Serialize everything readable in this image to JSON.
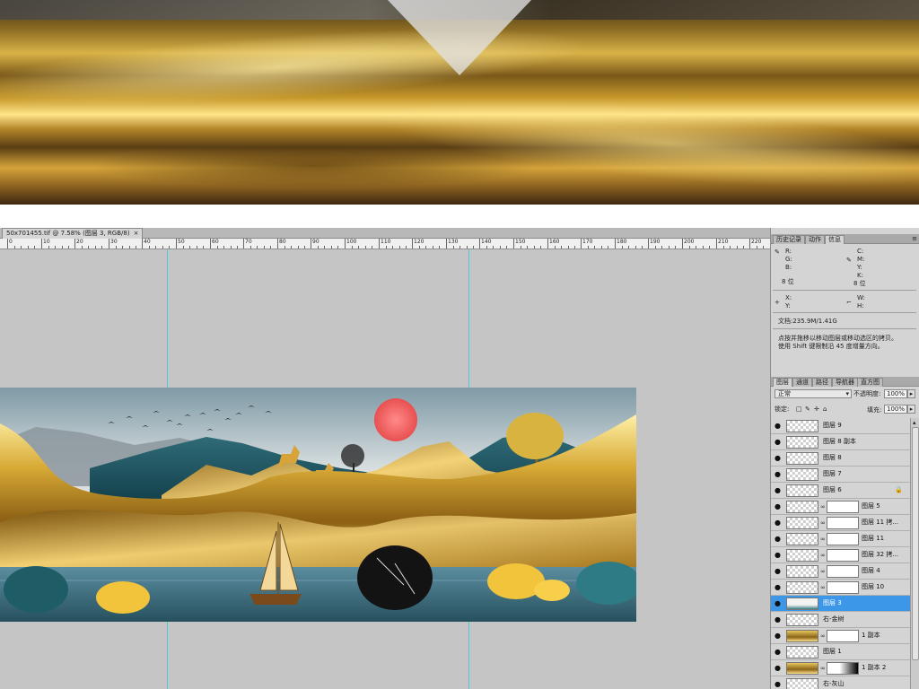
{
  "document": {
    "tab_title": "50x701455.tif @ 7.58% (图层 3, RGB/8)",
    "tab_close": "×",
    "ruler_labels": [
      "0",
      "10",
      "20",
      "30",
      "40",
      "50",
      "60",
      "70",
      "80",
      "90",
      "100",
      "110",
      "120",
      "130",
      "140",
      "150",
      "160",
      "170",
      "180",
      "190",
      "200",
      "210",
      "220"
    ]
  },
  "panels": {
    "tabs": [
      {
        "label": "历史记录",
        "active": false
      },
      {
        "label": "动作",
        "active": false
      },
      {
        "label": "信息",
        "active": true
      }
    ],
    "menu_glyph": "≡",
    "info": {
      "r": "R:",
      "g": "G:",
      "b": "B:",
      "c": "C:",
      "m": "M:",
      "y": "Y:",
      "k": "K:",
      "bit_left": "8 位",
      "bit_right": "8 位",
      "x": "X:",
      "ylbl": "Y:",
      "w": "W:",
      "h": "H:",
      "doc_size": "文档:235.9M/1.41G",
      "hint_line1": "点按并拖移以移动图层或移动选区的拷贝。",
      "hint_line2": "使用 Shift 键限制沿 45 度增量方向。"
    },
    "layers_tabs": [
      {
        "label": "图层",
        "active": true
      },
      {
        "label": "通道",
        "active": false
      },
      {
        "label": "路径",
        "active": false
      },
      {
        "label": "导航器",
        "active": false
      },
      {
        "label": "直方图",
        "active": false
      }
    ],
    "blend_mode": "正常",
    "opacity_label": "不透明度:",
    "opacity_value": "100%",
    "lock_label": "锁定:",
    "fill_label": "填充:",
    "fill_value": "100%",
    "layers": [
      {
        "name": "图层 9",
        "mask": "",
        "thumb": "checker",
        "selected": false,
        "locked": false
      },
      {
        "name": "图层 8 副本",
        "mask": "",
        "thumb": "checker",
        "selected": false,
        "locked": false
      },
      {
        "name": "图层 8",
        "mask": "",
        "thumb": "checker",
        "selected": false,
        "locked": false
      },
      {
        "name": "图层 7",
        "mask": "",
        "thumb": "checker",
        "selected": false,
        "locked": false
      },
      {
        "name": "图层 6",
        "mask": "",
        "thumb": "checker",
        "selected": false,
        "locked": true
      },
      {
        "name": "图层 5",
        "mask": "white",
        "thumb": "checker",
        "selected": false,
        "locked": false
      },
      {
        "name": "图层 11 拷...",
        "mask": "white",
        "thumb": "checker",
        "selected": false,
        "locked": false
      },
      {
        "name": "图层 11",
        "mask": "white",
        "thumb": "checker",
        "selected": false,
        "locked": false
      },
      {
        "name": "图层 32 拷...",
        "mask": "white",
        "thumb": "checker",
        "selected": false,
        "locked": false
      },
      {
        "name": "图层 4",
        "mask": "white",
        "thumb": "checker",
        "selected": false,
        "locked": false
      },
      {
        "name": "图层 10",
        "mask": "white",
        "thumb": "checker",
        "selected": false,
        "locked": false
      },
      {
        "name": "图层 3",
        "mask": "",
        "thumb": "teal",
        "selected": true,
        "locked": false
      },
      {
        "name": "右-金树",
        "mask": "",
        "thumb": "checker",
        "selected": false,
        "locked": false
      },
      {
        "name": "1 副本",
        "mask": "white",
        "thumb": "gold",
        "selected": false,
        "locked": false
      },
      {
        "name": "图层 1",
        "mask": "",
        "thumb": "checker",
        "selected": false,
        "locked": false
      },
      {
        "name": "1 副本 2",
        "mask": "dark",
        "thumb": "gold",
        "selected": false,
        "locked": false
      },
      {
        "name": "右-灰山",
        "mask": "",
        "thumb": "checker",
        "selected": false,
        "locked": false
      }
    ]
  }
}
